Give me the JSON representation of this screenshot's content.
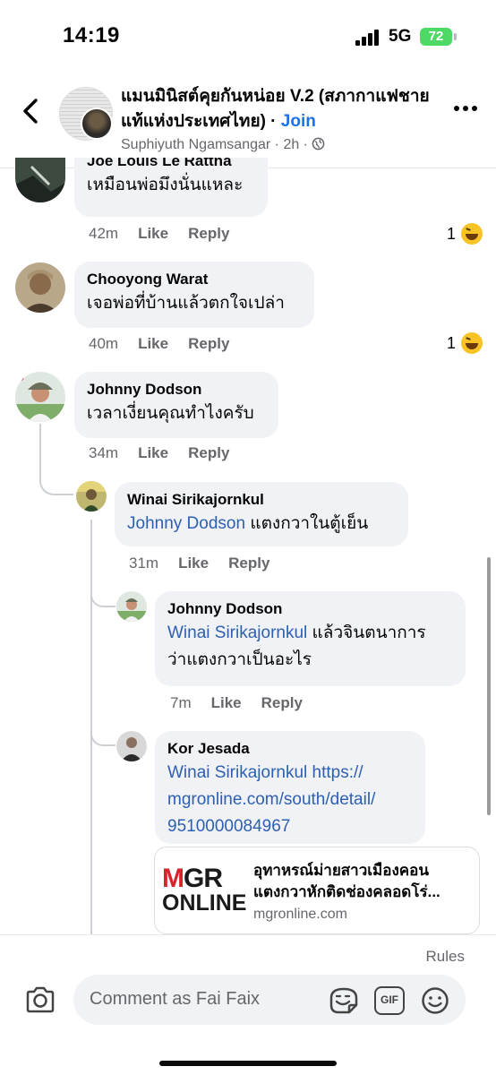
{
  "status": {
    "time": "14:19",
    "network": "5G",
    "battery": "72"
  },
  "header": {
    "title": "แมนมินิสต์คุยกันหน่อย V.2 (สภากาแฟชายแท้แห่งประเทศไทย) · ",
    "join": "Join",
    "author": "Suphiyuth Ngamsangar",
    "time": " · 2h · "
  },
  "comments": [
    {
      "name": "Joe Louis Le Rattha",
      "text": "เหมือนพ่อมึงนั่นแหละ",
      "time": "42m",
      "like": "Like",
      "reply": "Reply",
      "reactions": "1"
    },
    {
      "name": "Chooyong Warat",
      "text": "เจอพ่อที่บ้านแล้วตกใจเปล่า",
      "time": "40m",
      "like": "Like",
      "reply": "Reply",
      "reactions": "1"
    },
    {
      "name": "Johnny Dodson",
      "text": "เวลาเงี่ยนคุณทำไงครับ",
      "time": "34m",
      "like": "Like",
      "reply": "Reply"
    },
    {
      "name": "Winai Sirikajornkul",
      "mention": "Johnny Dodson",
      "text": " แตงกวาในตู้เย็น",
      "time": "31m",
      "like": "Like",
      "reply": "Reply"
    },
    {
      "name": "Johnny Dodson",
      "mention": "Winai Sirikajornkul",
      "text_line1": " แล้วจินตนาการ",
      "text_line2": "ว่าแตงกวาเป็นอะไร",
      "time": "7m",
      "like": "Like",
      "reply": "Reply"
    },
    {
      "name": "Kor Jesada",
      "mention": "Winai Sirikajornkul",
      "link_line1": " https://",
      "link_line2": "mgronline.com/south/detail/",
      "link_line3": "9510000084967"
    }
  ],
  "link_card": {
    "logo_m": "M",
    "logo_gr": "GR",
    "logo_online": "ONLINE",
    "title_line1": "อุทาหรณ์ม่ายสาวเมืองคอน",
    "title_line2": "แตงกวาหักติดช่องคลอดโร่...",
    "domain": "mgronline.com"
  },
  "composer": {
    "rules": "Rules",
    "placeholder": "Comment as Fai Faix",
    "gif": "GIF"
  },
  "icons": {
    "back": "chevron-left-icon",
    "more": "more-horizontal-icon",
    "globe": "globe-icon",
    "camera": "camera-icon",
    "sticker": "sticker-icon",
    "emoji": "smile-icon",
    "reaction": "laugh-emoji-icon"
  },
  "colors": {
    "accent": "#1b74e4",
    "mention": "#2d5fb3",
    "bubble": "#f0f2f5",
    "secondary_text": "#65676b",
    "battery": "#4cd964"
  }
}
